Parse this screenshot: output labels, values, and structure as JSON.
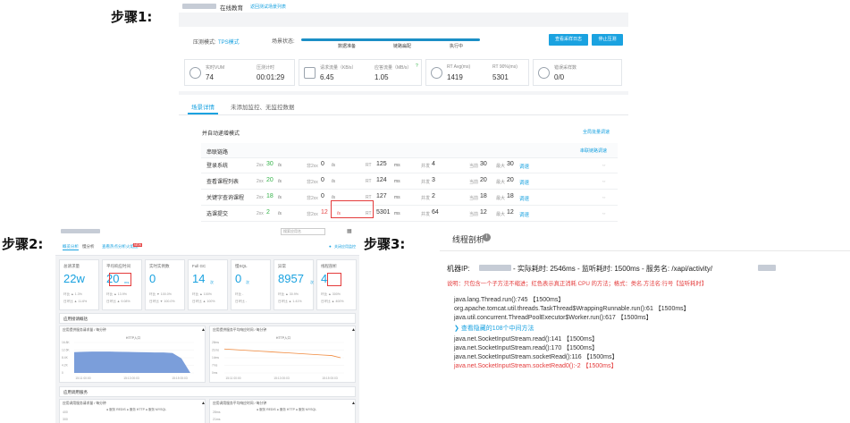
{
  "steps": {
    "s1": "步骤1:",
    "s2": "步骤2:",
    "s3": "步骤3:"
  },
  "panel1": {
    "header": {
      "brand": "在线教育",
      "back_link": "返回测试场景列表"
    },
    "mode_label": "压测模式:",
    "mode_value": "TPS模式",
    "scene_status_label": "场景状态:",
    "progress_steps": [
      "数据准备",
      "链路扁配",
      "执行中"
    ],
    "buttons": {
      "sampling_log": "查看采样日志",
      "stop": "停止压测"
    },
    "metrics": [
      {
        "label": "实时VUM",
        "value": "74",
        "icon": "gauge-icon"
      },
      {
        "label": "压测计时",
        "value": "00:01:29",
        "icon": ""
      },
      {
        "label": "请求流量（KB/s）",
        "value": "6.45",
        "icon": "traffic-icon"
      },
      {
        "label": "应答流量（MB/s）",
        "value": "1.05",
        "icon": ""
      },
      {
        "label": "RT Avg(ms)",
        "value": "1419",
        "icon": "clock-icon"
      },
      {
        "label": "RT 90%(ms)",
        "value": "5301",
        "icon": ""
      },
      {
        "label": "错误采样数",
        "value": "0/0",
        "icon": "alert-icon"
      }
    ],
    "tabs": [
      "场景详情",
      "未添加监控、无监控数据"
    ],
    "section_title": "并自动递增模式",
    "batch_adjust_link": "全局批量调速",
    "group_title": "串联链路",
    "group_adjust_link": "串联链路调速",
    "rows": [
      {
        "name": "登录系统",
        "ok_label": "2xx",
        "ok": "30",
        "fail_label": "非2xx",
        "fail": "0",
        "rt": "125",
        "concurrency": "4",
        "current": "30",
        "max": "30"
      },
      {
        "name": "查看课程列表",
        "ok_label": "2xx",
        "ok": "20",
        "fail_label": "非2xx",
        "fail": "0",
        "rt": "124",
        "concurrency": "3",
        "current": "20",
        "max": "20"
      },
      {
        "name": "关键字查询课程",
        "ok_label": "2xx",
        "ok": "18",
        "fail_label": "非2xx",
        "fail": "0",
        "rt": "127",
        "concurrency": "2",
        "current": "18",
        "max": "18"
      },
      {
        "name": "选课提交",
        "ok_label": "2xx",
        "ok": "2",
        "fail_label": "非2xx",
        "fail": "12",
        "rt": "5301",
        "concurrency": "64",
        "current": "12",
        "max": "12"
      }
    ],
    "unit_per_sec": "/s",
    "rt_label": "RT",
    "rt_unit": "ms",
    "conc_label": "并发",
    "cur_label": "当前",
    "max_label": "最大",
    "adjust_label": "调速"
  },
  "panel2": {
    "search_placeholder": "搜索应用名",
    "tabs": [
      "概览分析",
      "慢分析"
    ],
    "flame_link": "查看热点分析火焰图",
    "new_badge": "NEW",
    "right_link": "关闭应用监控",
    "cards": [
      {
        "label": "总请求量",
        "value": "22w",
        "sub1": "环比 ▲ 1.3%",
        "sub2": "日环比 ▲ 11.6%"
      },
      {
        "label": "平均响应时间",
        "value": "20",
        "unit": "ms",
        "sub1": "环比 ▲ 13.9%",
        "sub2": "日环比 ▲ 9.08%"
      },
      {
        "label": "实时实例数",
        "value": "0",
        "sub1": "环比 ▼ 100.0%",
        "sub2": "日环比 ▼ 100.0%"
      },
      {
        "label": "Full GC",
        "value": "14",
        "unit": "次",
        "sub1": "环比 ▲ 100%",
        "sub2": "日环比 ▲ 100%"
      },
      {
        "label": "慢SQL",
        "value": "0",
        "unit": "次",
        "sub1": "环比 -",
        "sub2": "日环比 -"
      },
      {
        "label": "异常",
        "value": "8957",
        "unit": "次",
        "sub1": "环比 ▲ 30.9%",
        "sub2": "日环比 ▲ 1.41%"
      },
      {
        "label": "线程剖析",
        "value": "4",
        "sub1": "环比 ▲ 300%",
        "sub2": "日环比 ▲ 400%"
      }
    ],
    "section1": "应用接请概括",
    "chart1_title": "应用提供服务请求量 / 每分钟",
    "chart2_title": "应用提供服务平均响应时间 / 每分钟",
    "legend1": "HTTP入口",
    "legend2": "HTTP入口",
    "y_ticks_left": [
      "16.8K",
      "12.6K",
      "8.4K",
      "4.2K",
      "0"
    ],
    "y_ticks_right": [
      "28ms",
      "21ms",
      "14ms",
      "7ms",
      "0ms"
    ],
    "x_ticks": [
      "15:11 00:00",
      "15:13 00:03",
      "15:15 00:03"
    ],
    "section2": "应用调用服务",
    "chart3_title": "应用调用服务请求量 / 每分钟",
    "chart4_title": "应用调用服务平均响应时间 / 每分钟",
    "legend3": [
      "服务 REDIS",
      "服务 HTTP",
      "服务 MYSQL"
    ],
    "legend4": [
      "服务 REDIS",
      "服务 HTTP",
      "服务 MYSQL"
    ],
    "y_ticks_small_left": [
      "400",
      "300"
    ],
    "y_ticks_small_right": [
      "28ms",
      "21ms"
    ],
    "chart_data": [
      {
        "type": "area",
        "title": "应用提供服务请求量 / 每分钟",
        "series": [
          {
            "name": "HTTP入口",
            "values": [
              11500,
              11700,
              11800,
              11800,
              11800,
              11700,
              11600,
              11500,
              11400,
              11300,
              11300,
              11000,
              8000,
              0
            ]
          }
        ],
        "ylim": [
          0,
          16800
        ]
      },
      {
        "type": "line",
        "title": "应用提供服务平均响应时间 / 每分钟",
        "series": [
          {
            "name": "HTTP入口",
            "values": [
              22,
              21.5,
              21,
              20.5,
              20,
              19.5,
              19,
              18.5,
              18,
              17.5,
              17,
              16.5,
              16,
              14
            ]
          }
        ],
        "ylim": [
          0,
          28
        ]
      }
    ]
  },
  "panel3": {
    "title": "线程剖析",
    "summary_prefix": "机器IP:",
    "summary_mid": "- 实际耗时: 2546ms - 监听耗时: 1500ms - 服务名: /xapi/activity/",
    "note": "说明：只包含一个子方法不缩进；红色表示真正消耗 CPU 的方法；格式：类名.方法名:行号【监听耗时】",
    "lines": [
      {
        "text": "java.lang.Thread.run():745 【1500ms】",
        "red": false
      },
      {
        "text": "org.apache.tomcat.util.threads.TaskThread$WrappingRunnable.run():61 【1500ms】",
        "red": false
      },
      {
        "text": "java.util.concurrent.ThreadPoolExecutor$Worker.run():617 【1500ms】",
        "red": false
      }
    ],
    "expand_text": "查看隐藏的108个中间方法",
    "lines2": [
      {
        "text": "java.net.SocketInputStream.read():141 【1500ms】",
        "red": false
      },
      {
        "text": "java.net.SocketInputStream.read():170 【1500ms】",
        "red": false
      },
      {
        "text": "java.net.SocketInputStream.socketRead():116 【1500ms】",
        "red": false
      },
      {
        "text": "java.net.SocketInputStream.socketRead0():-2 【1500ms】",
        "red": true
      }
    ]
  }
}
